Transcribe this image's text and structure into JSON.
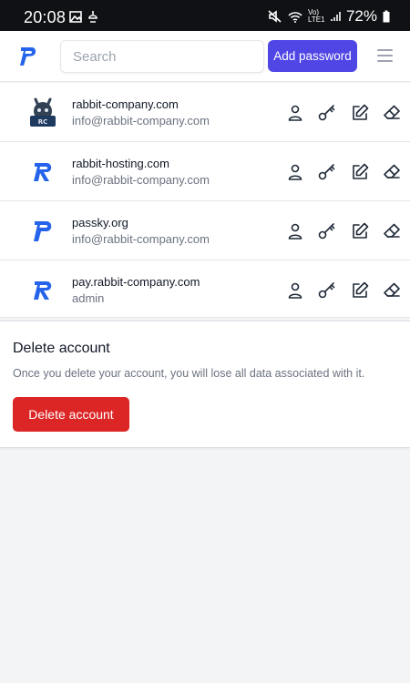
{
  "status_bar": {
    "time": "20:08",
    "battery": "72%",
    "network_label": "Vo) LTE1"
  },
  "header": {
    "search_placeholder": "Search",
    "add_label": "Add password"
  },
  "passwords": [
    {
      "website": "rabbit-company.com",
      "username": "info@rabbit-company.com",
      "icon": "rabbit-company-favicon"
    },
    {
      "website": "rabbit-hosting.com",
      "username": "info@rabbit-company.com",
      "icon": "rabbit-hosting-favicon"
    },
    {
      "website": "passky.org",
      "username": "info@rabbit-company.com",
      "icon": "passky-favicon"
    },
    {
      "website": "pay.rabbit-company.com",
      "username": "admin",
      "icon": "rabbit-hosting-favicon"
    }
  ],
  "delete_account": {
    "title": "Delete account",
    "description": "Once you delete your account, you will lose all data associated with it.",
    "button_label": "Delete account"
  },
  "colors": {
    "accent": "#4f46e5",
    "danger": "#dc2626",
    "passky_blue": "#2563eb"
  }
}
